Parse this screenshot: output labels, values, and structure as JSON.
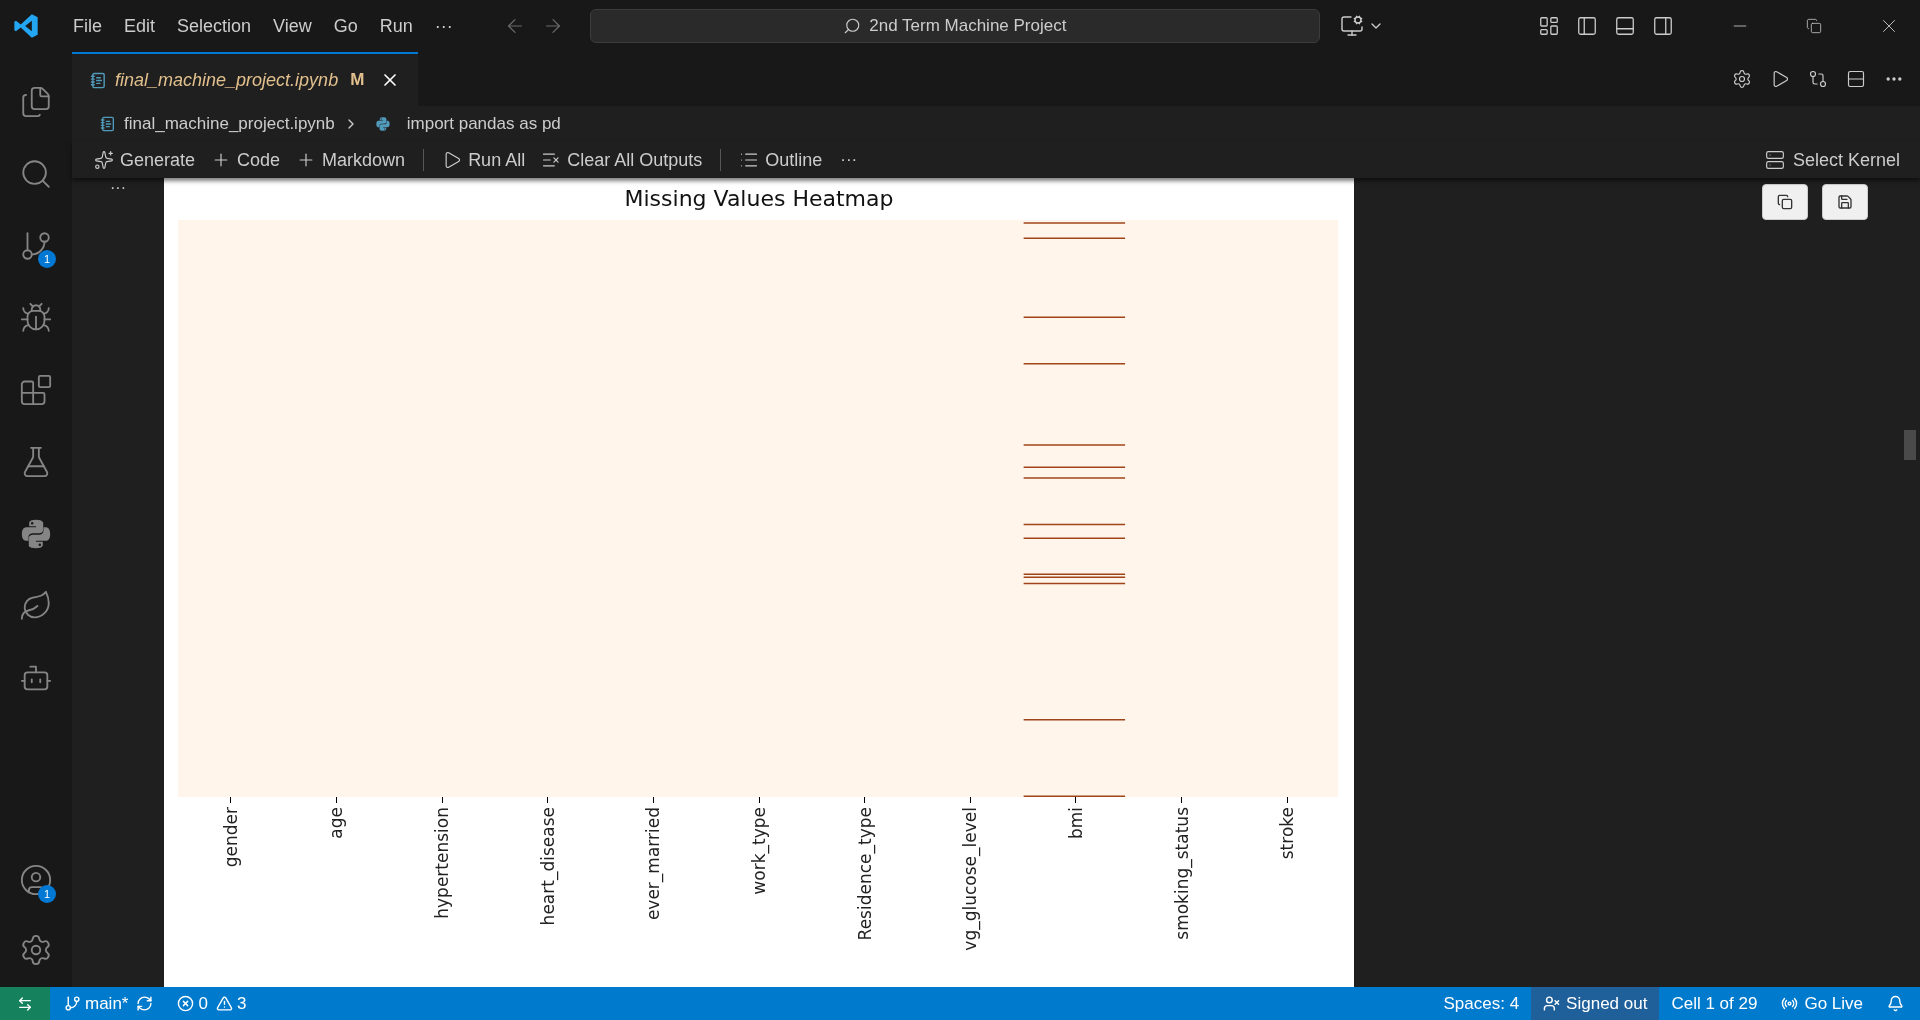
{
  "menu": [
    "File",
    "Edit",
    "Selection",
    "View",
    "Go",
    "Run",
    "···"
  ],
  "command_center": {
    "text": "2nd Term Machine Project"
  },
  "activity_bar": [
    {
      "kind": "explorer",
      "selected": false
    },
    {
      "kind": "search",
      "selected": false
    },
    {
      "kind": "source-control",
      "selected": false,
      "badge": "1"
    },
    {
      "kind": "run",
      "selected": false
    },
    {
      "kind": "extensions",
      "selected": false
    },
    {
      "kind": "testing",
      "selected": false
    },
    {
      "kind": "python",
      "selected": false
    },
    {
      "kind": "leaf",
      "selected": false
    },
    {
      "kind": "copilot",
      "selected": false
    }
  ],
  "activity_bottom": [
    {
      "kind": "account",
      "badge": "1"
    },
    {
      "kind": "settings"
    }
  ],
  "tabs": [
    {
      "label": "final_machine_project.ipynb",
      "status": "M",
      "selected": true
    }
  ],
  "breadcrumbs": [
    "final_machine_project.ipynb",
    "import pandas as pd"
  ],
  "toolbar": [
    {
      "kind": "generate",
      "label": "Generate"
    },
    {
      "kind": "plus",
      "label": "Code"
    },
    {
      "kind": "plus",
      "label": "Markdown"
    },
    {
      "kind": "sep"
    },
    {
      "kind": "run",
      "label": "Run All"
    },
    {
      "kind": "clear",
      "label": "Clear All Outputs"
    },
    {
      "kind": "sep"
    },
    {
      "kind": "outline",
      "label": "Outline"
    },
    {
      "kind": "more",
      "label": "···"
    }
  ],
  "kernel": "Select Kernel",
  "cell_more": "···",
  "heatmap": {
    "title": "Missing Values Heatmap",
    "columns": [
      {
        "label": "gender",
        "has_missing": false
      },
      {
        "label": "age",
        "has_missing": false
      },
      {
        "label": "hypertension",
        "has_missing": false
      },
      {
        "label": "heart_disease",
        "has_missing": false
      },
      {
        "label": "ever_married",
        "has_missing": false
      },
      {
        "label": "work_type",
        "has_missing": false
      },
      {
        "label": "Residence_type",
        "has_missing": false
      },
      {
        "label": "vg_glucose_level",
        "has_missing": false
      },
      {
        "label": "bmi",
        "has_missing": true
      },
      {
        "label": "smoking_status",
        "has_missing": false
      },
      {
        "label": "stroke",
        "has_missing": false
      }
    ]
  },
  "status_bar": {
    "branch": "main*",
    "errors": "0",
    "warnings": "3",
    "right": [
      {
        "kind": "text",
        "label": "Spaces: 4",
        "selected": false
      },
      {
        "kind": "signed-out",
        "label": "Signed out",
        "selected": true
      },
      {
        "kind": "text",
        "label": "Cell 1 of 29",
        "selected": false
      },
      {
        "kind": "live",
        "label": "Go Live",
        "selected": false
      },
      {
        "kind": "bell",
        "selected": false
      }
    ]
  }
}
